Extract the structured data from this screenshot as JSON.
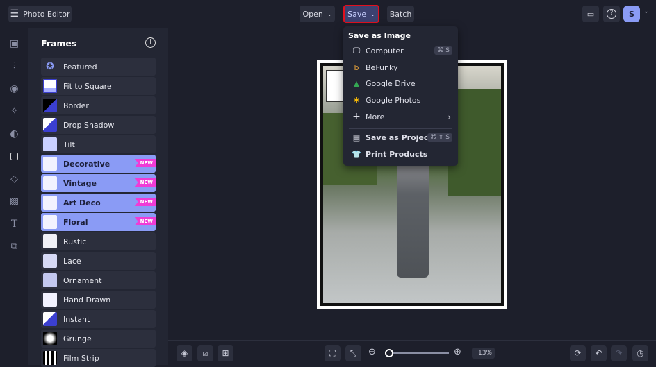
{
  "header": {
    "app_title": "Photo Editor",
    "open_label": "Open",
    "save_label": "Save",
    "batch_label": "Batch",
    "avatar_initial": "S"
  },
  "panel": {
    "title": "Frames",
    "items": [
      {
        "label": "Featured",
        "new": false
      },
      {
        "label": "Fit to Square",
        "new": false
      },
      {
        "label": "Border",
        "new": false
      },
      {
        "label": "Drop Shadow",
        "new": false
      },
      {
        "label": "Tilt",
        "new": false
      },
      {
        "label": "Decorative",
        "new": true
      },
      {
        "label": "Vintage",
        "new": true
      },
      {
        "label": "Art Deco",
        "new": true
      },
      {
        "label": "Floral",
        "new": true
      },
      {
        "label": "Rustic",
        "new": false
      },
      {
        "label": "Lace",
        "new": false
      },
      {
        "label": "Ornament",
        "new": false
      },
      {
        "label": "Hand Drawn",
        "new": false
      },
      {
        "label": "Instant",
        "new": false
      },
      {
        "label": "Grunge",
        "new": false
      },
      {
        "label": "Film Strip",
        "new": false
      }
    ],
    "new_badge": "NEW"
  },
  "save_menu": {
    "heading": "Save as Image",
    "computer": "Computer",
    "computer_shortcut": "⌘ S",
    "befunky": "BeFunky",
    "google_drive": "Google Drive",
    "google_photos": "Google Photos",
    "more": "More",
    "save_project": "Save as Project",
    "save_project_shortcut": "⌘ ⇧ S",
    "print_products": "Print Products"
  },
  "bottom": {
    "zoom_value": "13%",
    "zoom_fraction": 0.0
  },
  "colors": {
    "accent": "#8a9bf5",
    "new_badge": "#f03bd6",
    "save_highlight": "#e0101e"
  }
}
